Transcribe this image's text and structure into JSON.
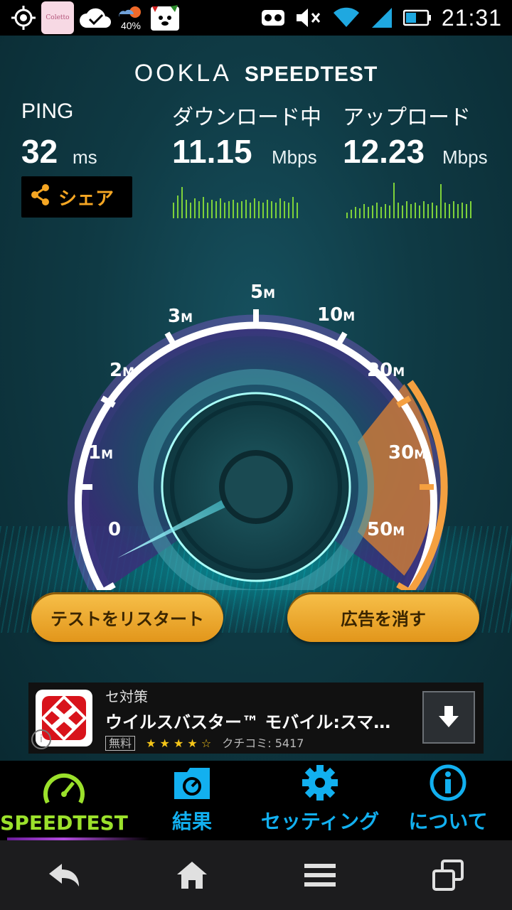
{
  "status_bar": {
    "time": "21:31",
    "battery_percent": "40%",
    "calendar_app_label": "Coletto",
    "icons": [
      "gps-icon",
      "calendar-app-icon",
      "cloud-check-icon",
      "weather-icon",
      "dog-app-icon",
      "voicemail-icon",
      "mute-icon",
      "wifi-icon",
      "signal-icon",
      "battery-icon"
    ]
  },
  "brand": {
    "ookla": "OOKLA",
    "speedtest": "SPEEDTEST"
  },
  "stats": {
    "ping": {
      "label": "PING",
      "value": "32",
      "unit": "ms"
    },
    "download": {
      "label": "ダウンロード中",
      "value": "11.15",
      "unit": "Mbps"
    },
    "upload": {
      "label": "アップロード",
      "value": "12.23",
      "unit": "Mbps"
    }
  },
  "share_label": "シェア",
  "gauge": {
    "scale": [
      {
        "label": "0",
        "unit": ""
      },
      {
        "label": "1",
        "unit": "M"
      },
      {
        "label": "2",
        "unit": "M"
      },
      {
        "label": "3",
        "unit": "M"
      },
      {
        "label": "5",
        "unit": "M"
      },
      {
        "label": "10",
        "unit": "M"
      },
      {
        "label": "20",
        "unit": "M"
      },
      {
        "label": "30",
        "unit": "M"
      },
      {
        "label": "50",
        "unit": "M"
      }
    ],
    "colors": {
      "ring": "#ffffff",
      "glow_purple": "#a45cf0",
      "glow_orange": "#f5a040",
      "needle": "#7ff0ff"
    }
  },
  "buttons": {
    "restart": "テストをリスタート",
    "remove_ads": "広告を消す"
  },
  "ad": {
    "top_text": "セ対策",
    "title": "ウイルスバスター™ モバイル:スマ…",
    "price": "無料",
    "rating_count": "クチコミ: 5417",
    "info": "i"
  },
  "tabs": [
    {
      "label": "SPEEDTEST",
      "icon": "speedometer-icon",
      "active": true
    },
    {
      "label": "結果",
      "icon": "results-folder-icon",
      "active": false
    },
    {
      "label": "セッティング",
      "icon": "gear-icon",
      "active": false
    },
    {
      "label": "について",
      "icon": "info-icon",
      "active": false
    }
  ],
  "nav": [
    "back-icon",
    "home-icon",
    "menu-icon",
    "recent-apps-icon"
  ],
  "accent_colors": {
    "green": "#9be12b",
    "blue": "#12b0f0",
    "orange": "#f5a623"
  }
}
